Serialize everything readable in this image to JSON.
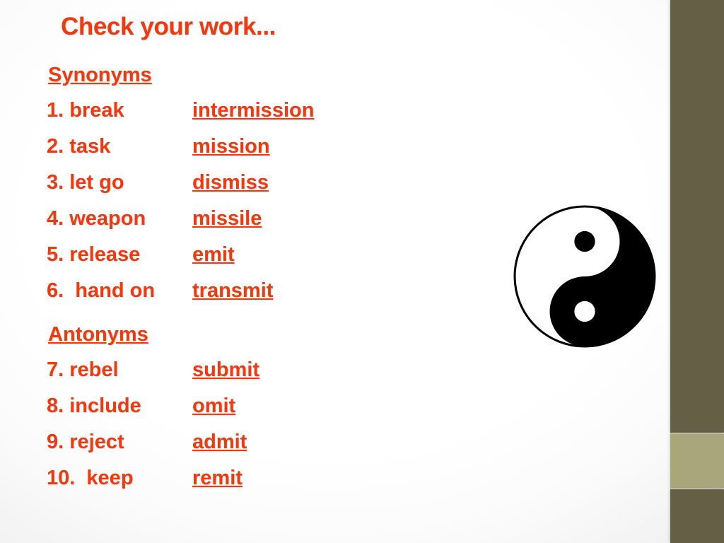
{
  "slide": {
    "title": "Check your work...",
    "accent_color": "#F0390F",
    "bar_dark_color": "#655F45",
    "bar_light_color": "#AAA67B",
    "background_color": "#FFFFFF"
  },
  "sections": [
    {
      "heading": "Synonyms",
      "rows": [
        {
          "term": "1. break",
          "answer": "intermission"
        },
        {
          "term": "2. task",
          "answer": "mission"
        },
        {
          "term": "3. let go",
          "answer": "dismiss"
        },
        {
          "term": "4. weapon",
          "answer": "missile"
        },
        {
          "term": "5. release",
          "answer": "emit"
        },
        {
          "term": "6.  hand on",
          "answer": "transmit"
        }
      ]
    },
    {
      "heading": "Antonyms",
      "rows": [
        {
          "term": "7. rebel",
          "answer": "submit"
        },
        {
          "term": "8. include",
          "answer": "omit"
        },
        {
          "term": "9. reject",
          "answer": "admit"
        },
        {
          "term": "10.  keep",
          "answer": "remit"
        }
      ]
    }
  ],
  "image": {
    "name": "yin-yang-symbol",
    "outer_color": "#000000",
    "light_half_color": "#FFFFFF",
    "dark_half_color": "#000000"
  }
}
